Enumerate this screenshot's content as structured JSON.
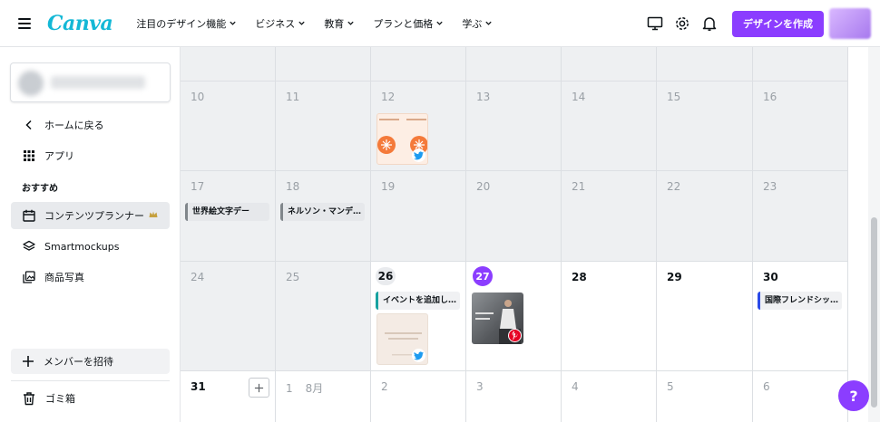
{
  "header": {
    "logo": "Canva",
    "nav": [
      {
        "label": "注目のデザイン機能"
      },
      {
        "label": "ビジネス"
      },
      {
        "label": "教育"
      },
      {
        "label": "プランと価格"
      },
      {
        "label": "学ぶ"
      }
    ],
    "create_button": "デザインを作成",
    "icons": [
      "desktop-icon",
      "gear-icon",
      "bell-icon"
    ]
  },
  "sidebar": {
    "back_home": "ホームに戻る",
    "apps": "アプリ",
    "section": "おすすめ",
    "items": [
      {
        "label": "コンテンツプランナー",
        "icon": "calendar-icon",
        "active": true,
        "crown": true
      },
      {
        "label": "Smartmockups",
        "icon": "layers-icon"
      },
      {
        "label": "商品写真",
        "icon": "images-icon"
      }
    ],
    "invite": "メンバーを招待",
    "trash": "ゴミ箱"
  },
  "calendar": {
    "week_10": [
      "10",
      "11",
      "12",
      "13",
      "14",
      "15",
      "16"
    ],
    "week_17": [
      "17",
      "18",
      "19",
      "20",
      "21",
      "22",
      "23"
    ],
    "week_24": [
      "24",
      "25",
      "26",
      "27",
      "28",
      "29",
      "30"
    ],
    "week_31": [
      "31",
      "1",
      "2",
      "3",
      "4",
      "5",
      "6"
    ],
    "next_month": "8月",
    "events": {
      "d17": "世界絵文字デー",
      "d18": "ネルソン・マンデ…",
      "d26": "イベントを追加し…",
      "d30": "国際フレンドシッ…"
    },
    "social": {
      "d12": "twitter-icon",
      "d26": "twitter-icon",
      "d27": "pinterest-icon"
    }
  },
  "help": "?",
  "colors": {
    "brand": "#8b3dff",
    "logo": "#14b8d6"
  }
}
